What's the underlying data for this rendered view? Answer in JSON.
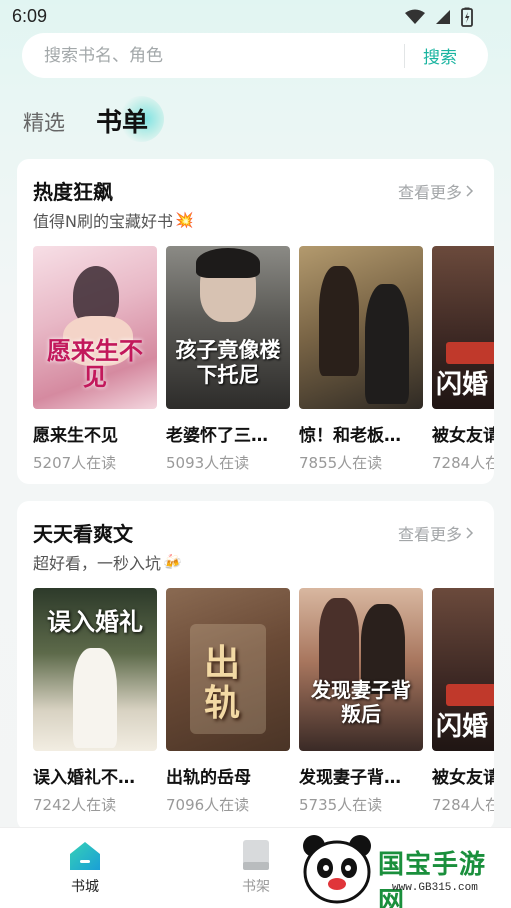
{
  "status_bar": {
    "time": "6:09"
  },
  "search": {
    "placeholder": "搜索书名、角色",
    "button_label": "搜索"
  },
  "tabs": [
    {
      "label": "精选"
    },
    {
      "label": "书单"
    }
  ],
  "sections": [
    {
      "title": "热度狂飙",
      "subtitle": "值得N刷的宝藏好书",
      "subtitle_emoji": "💥",
      "more_label": "查看更多",
      "books": [
        {
          "title": "愿来生不见",
          "readers": "5207人在读",
          "cover_text": "愿来生不见"
        },
        {
          "title": "老婆怀了三…",
          "readers": "5093人在读",
          "cover_text": "孩子竟像楼下托尼"
        },
        {
          "title": "惊！和老板…",
          "readers": "7855人在读",
          "cover_text": ""
        },
        {
          "title": "被女友请",
          "readers": "7284人在",
          "cover_text": "闪婚"
        }
      ]
    },
    {
      "title": "天天看爽文",
      "subtitle": "超好看，一秒入坑",
      "subtitle_emoji": "🍻",
      "more_label": "查看更多",
      "books": [
        {
          "title": "误入婚礼不…",
          "readers": "7242人在读",
          "cover_text": "误入婚礼"
        },
        {
          "title": "出轨的岳母",
          "readers": "7096人在读",
          "cover_text": "出轨"
        },
        {
          "title": "发现妻子背…",
          "readers": "5735人在读",
          "cover_text": "发现妻子背叛后"
        },
        {
          "title": "被女友请",
          "readers": "7284人在",
          "cover_text": "闪婚"
        }
      ]
    }
  ],
  "bottom_nav": [
    {
      "label": "书城",
      "icon": "home-icon",
      "active": true
    },
    {
      "label": "书架",
      "icon": "bookshelf-icon",
      "active": false
    }
  ],
  "watermark": {
    "text": "国宝手游网",
    "sub": "www.GB315.com"
  },
  "colors": {
    "accent": "#19b4a0",
    "text_primary": "#111111",
    "text_secondary": "#999999"
  }
}
